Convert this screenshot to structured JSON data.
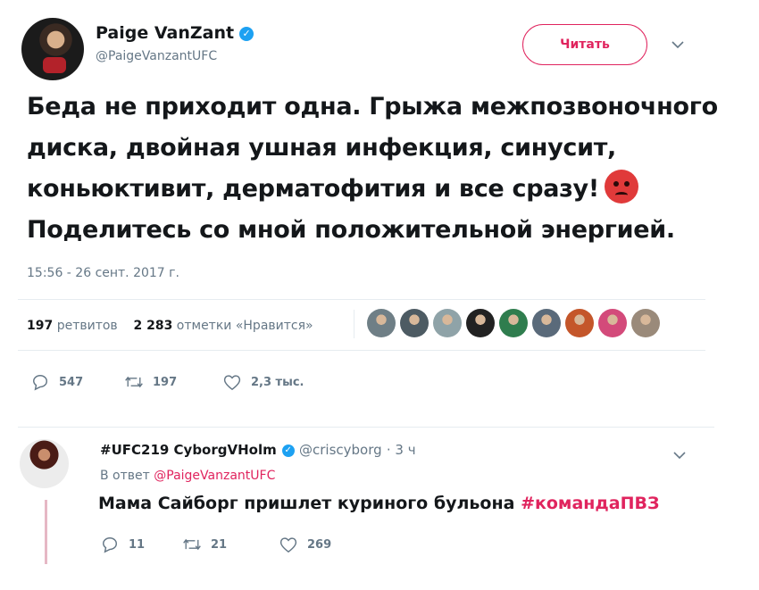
{
  "author": {
    "name": "Paige VanZant",
    "handle": "@PaigeVanzantUFC",
    "follow_label": "Читать"
  },
  "tweet": {
    "lines": [
      "Беда не приходит одна. Грыжа межпозвоночного",
      "диска, двойная ушная инфекция, синусит,",
      "коньюктивит, дерматофития и все сразу!",
      "Поделитесь со мной положительной энергией."
    ],
    "emoji": "angry-face",
    "timestamp": "15:56 - 26 сент. 2017 г."
  },
  "stats": {
    "retweets_num": "197",
    "retweets_label": "ретвитов",
    "likes_num": "2 283",
    "likes_label": "отметки «Нравится»",
    "liker_colors": [
      "#6f7f86",
      "#4d5b63",
      "#8fa3a8",
      "#222222",
      "#2f7d4e",
      "#5a6a7a",
      "#c4562a",
      "#d34a7a",
      "#9a8a7a"
    ]
  },
  "actions": {
    "replies": "547",
    "retweets": "197",
    "likes": "2,3 тыс."
  },
  "reply": {
    "name": "#UFC219 CyborgVHolm",
    "handle": "@criscyborg",
    "time": "· 3 ч",
    "reply_to_prefix": "В ответ",
    "reply_to_handle": "@PaigeVanzantUFC",
    "text": "Мама Сайборг пришлет куриного бульона",
    "hashtag": "#командаПВЗ",
    "actions": {
      "replies": "11",
      "retweets": "21",
      "likes": "269"
    }
  },
  "colors": {
    "accent": "#e0245e",
    "verified": "#1da1f2",
    "muted": "#657786"
  }
}
